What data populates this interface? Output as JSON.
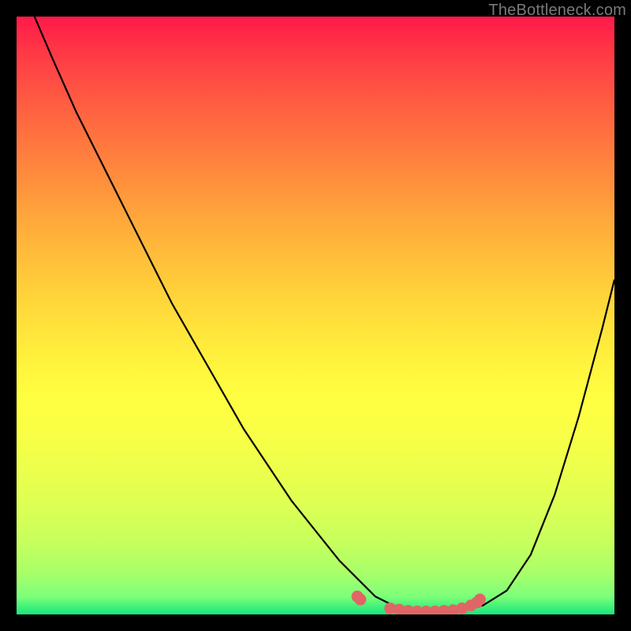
{
  "watermark": "TheBottleneck.com",
  "colors": {
    "background": "#000000",
    "curve": "#000000",
    "marker": "#e06666",
    "gradient_top": "#ff1a49",
    "gradient_bottom": "#16e77b"
  },
  "chart_data": {
    "type": "line",
    "title": "",
    "xlabel": "",
    "ylabel": "",
    "xlim": [
      0,
      100
    ],
    "ylim": [
      0,
      100
    ],
    "annotations": [],
    "series": [
      {
        "name": "bottleneck-curve",
        "x": [
          3,
          6,
          10,
          14,
          18,
          22,
          26,
          30,
          34,
          38,
          42,
          46,
          50,
          54,
          58,
          60,
          63,
          66,
          70,
          74,
          78,
          82,
          86,
          90,
          94,
          98,
          100
        ],
        "y": [
          100,
          93,
          84,
          76,
          68,
          60,
          52,
          45,
          38,
          31,
          25,
          19,
          14,
          9,
          5,
          3,
          1.5,
          0.8,
          0.5,
          0.7,
          1.5,
          4,
          10,
          20,
          33,
          48,
          56
        ]
      }
    ],
    "markers": {
      "name": "bottom-markers",
      "x": [
        57.0,
        57.5,
        62.5,
        64.0,
        65.5,
        67.0,
        68.5,
        70.0,
        71.5,
        73.0,
        74.5,
        76.0,
        77.0,
        77.5
      ],
      "y": [
        3.0,
        2.5,
        1.0,
        0.8,
        0.6,
        0.5,
        0.5,
        0.5,
        0.6,
        0.7,
        1.0,
        1.5,
        2.0,
        2.5
      ]
    }
  }
}
